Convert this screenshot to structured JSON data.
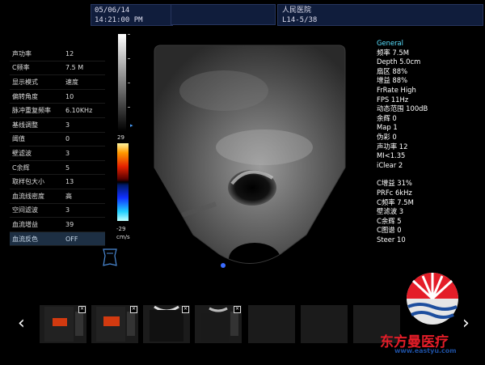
{
  "header": {
    "date": "05/06/14",
    "time": "14:21:00 PM",
    "hospital": "人民医院",
    "probe_preset": "L14-5/38"
  },
  "left_params": [
    {
      "label": "声功率",
      "value": "12"
    },
    {
      "label": "C频率",
      "value": "7.5 M"
    },
    {
      "label": "显示模式",
      "value": "速度"
    },
    {
      "label": "偏转角度",
      "value": "10"
    },
    {
      "label": "脉冲重复频率",
      "value": "6.10KHz"
    },
    {
      "label": "基线调整",
      "value": "3"
    },
    {
      "label": "阈值",
      "value": "0"
    },
    {
      "label": "壁滤波",
      "value": "3"
    },
    {
      "label": "C余辉",
      "value": "5"
    },
    {
      "label": "取样包大小",
      "value": "13"
    },
    {
      "label": "血流线密度",
      "value": "高"
    },
    {
      "label": "空间滤波",
      "value": "3"
    },
    {
      "label": "血流增益",
      "value": "39"
    },
    {
      "label": "血流反色",
      "value": "OFF",
      "selected": true
    }
  ],
  "colorbar": {
    "top": "29",
    "bottom": "-29",
    "unit": "cm/s"
  },
  "info_general": {
    "header": "General",
    "lines": [
      "频率 7.5M",
      "Depth 5.0cm",
      "扇区 88%",
      "增益 88%",
      "FrRate High",
      "FPS 11Hz",
      "动态范围 100dB",
      "余辉 0",
      "Map 1",
      "伪彩 0",
      "声功率 12",
      "MI<1.35",
      "iClear 2"
    ]
  },
  "info_color": {
    "lines": [
      "C增益 31%",
      "PRFc 6kHz",
      "C频率 7.5M",
      "壁滤波 3",
      "C余辉 5",
      "C图谱 0",
      "Steer 10"
    ]
  },
  "thumbnails": {
    "close_glyph": "×",
    "prev": "‹",
    "next": "›"
  },
  "logo": {
    "name": "东方曼医疗",
    "url": "www.eastyu.com"
  },
  "colors": {
    "accent": "#59e0ff",
    "panel": "#101d3c",
    "brand_red": "#e41d28",
    "brand_blue": "#1d4e9e"
  }
}
